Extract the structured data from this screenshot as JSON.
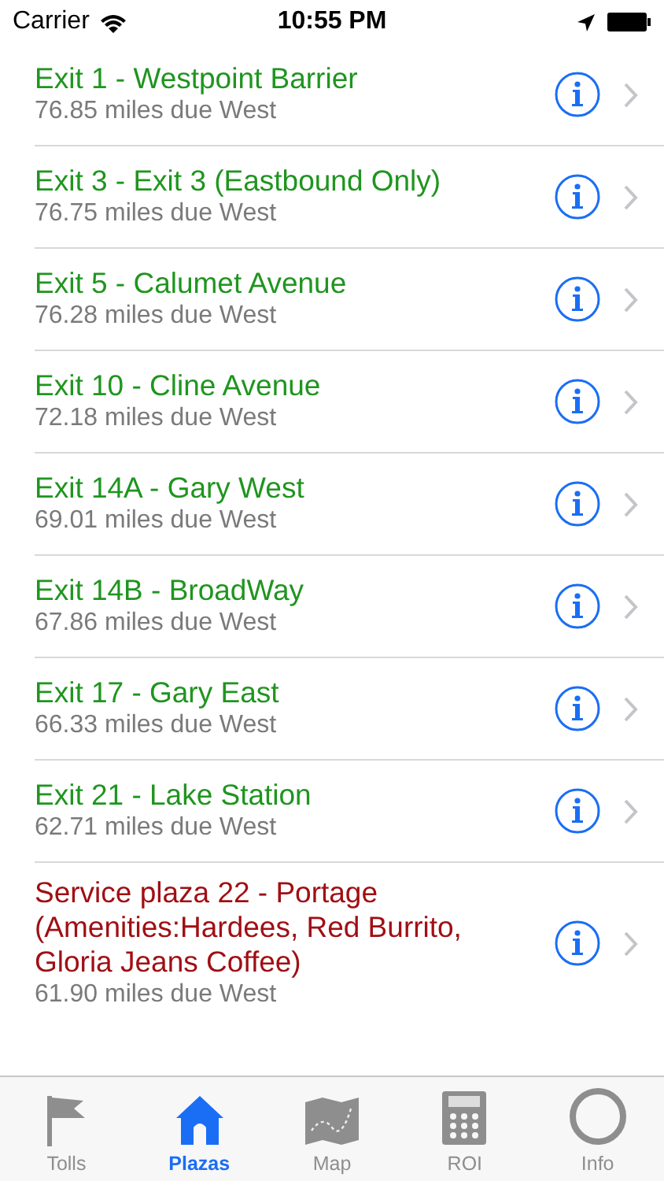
{
  "status_bar": {
    "carrier": "Carrier",
    "time": "10:55 PM"
  },
  "rows": [
    {
      "kind": "exit",
      "title": "Exit 1 - Westpoint Barrier",
      "distance": "76.85 miles due West"
    },
    {
      "kind": "exit",
      "title": "Exit 3 - Exit 3 (Eastbound Only)",
      "distance": "76.75 miles due West"
    },
    {
      "kind": "exit",
      "title": "Exit 5 - Calumet Avenue",
      "distance": "76.28 miles due West"
    },
    {
      "kind": "exit",
      "title": "Exit 10 - Cline Avenue",
      "distance": "72.18 miles due West"
    },
    {
      "kind": "exit",
      "title": "Exit 14A - Gary West",
      "distance": "69.01 miles due West"
    },
    {
      "kind": "exit",
      "title": "Exit 14B - BroadWay",
      "distance": "67.86 miles due West"
    },
    {
      "kind": "exit",
      "title": "Exit 17 - Gary East",
      "distance": "66.33 miles due West"
    },
    {
      "kind": "exit",
      "title": "Exit 21 - Lake Station",
      "distance": "62.71 miles due West"
    },
    {
      "kind": "plaza",
      "title": "Service plaza 22 - Portage (Amenities:Hardees, Red Burrito, Gloria Jeans Coffee)",
      "distance": "61.90 miles due West"
    }
  ],
  "tabs": [
    {
      "kind": "flag",
      "label": "Tolls",
      "selected": false
    },
    {
      "kind": "house",
      "label": "Plazas",
      "selected": true
    },
    {
      "kind": "map",
      "label": "Map",
      "selected": false
    },
    {
      "kind": "calc",
      "label": "ROI",
      "selected": false
    },
    {
      "kind": "circle",
      "label": "Info",
      "selected": false
    }
  ]
}
